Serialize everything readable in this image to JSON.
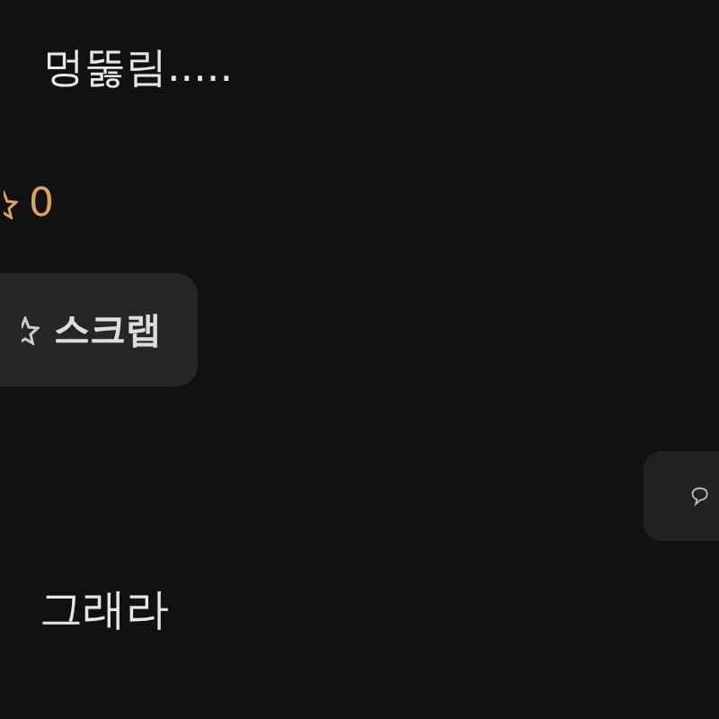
{
  "post_text": "멍뚫림.....",
  "like_count": "0",
  "scrap_button": {
    "label": "스크랩"
  },
  "comment_text": "그래라"
}
